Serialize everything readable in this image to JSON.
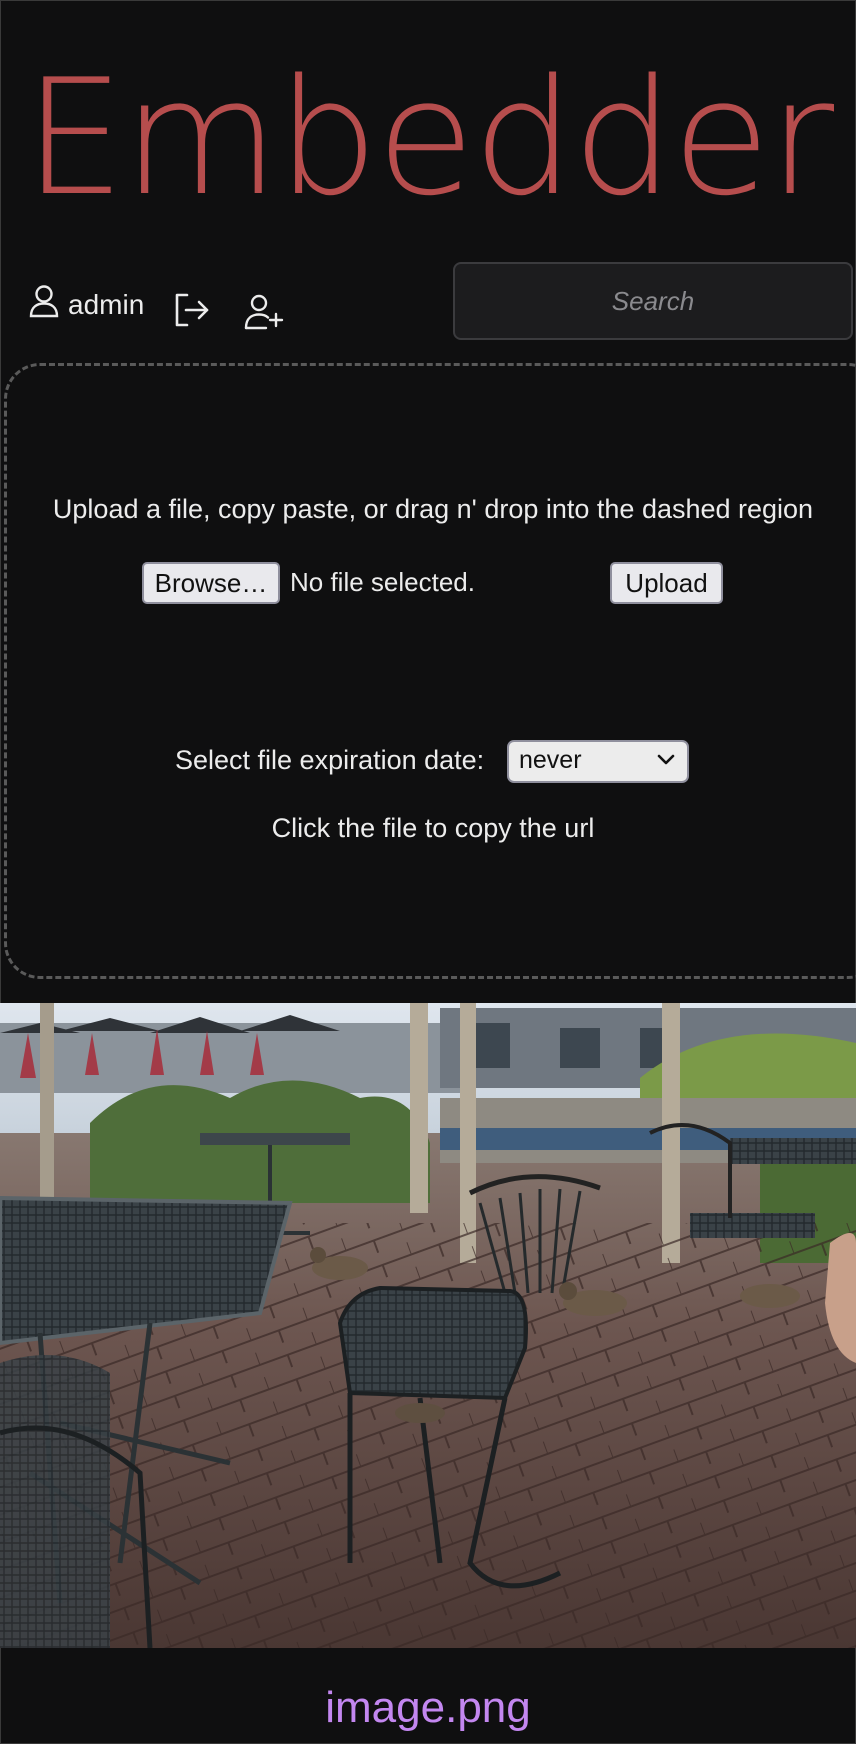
{
  "app": {
    "title": "Embedder"
  },
  "user": {
    "name": "admin",
    "icon": "user-icon"
  },
  "header": {
    "logout_icon": "logout-icon",
    "add_user_icon": "add-user-icon"
  },
  "search": {
    "placeholder": "Search",
    "value": ""
  },
  "upload": {
    "instructions": "Upload a file, copy paste, or drag n' drop into the dashed region",
    "browse_label": "Browse…",
    "file_status": "No file selected.",
    "upload_label": "Upload",
    "expiration_label": "Select file expiration date:",
    "expiration_value": "never",
    "copy_hint": "Click the file to copy the url"
  },
  "files": [
    {
      "name": "image.png"
    }
  ],
  "colors": {
    "background": "#0f0f10",
    "title": "#b64d4d",
    "filename": "#c387f0"
  }
}
